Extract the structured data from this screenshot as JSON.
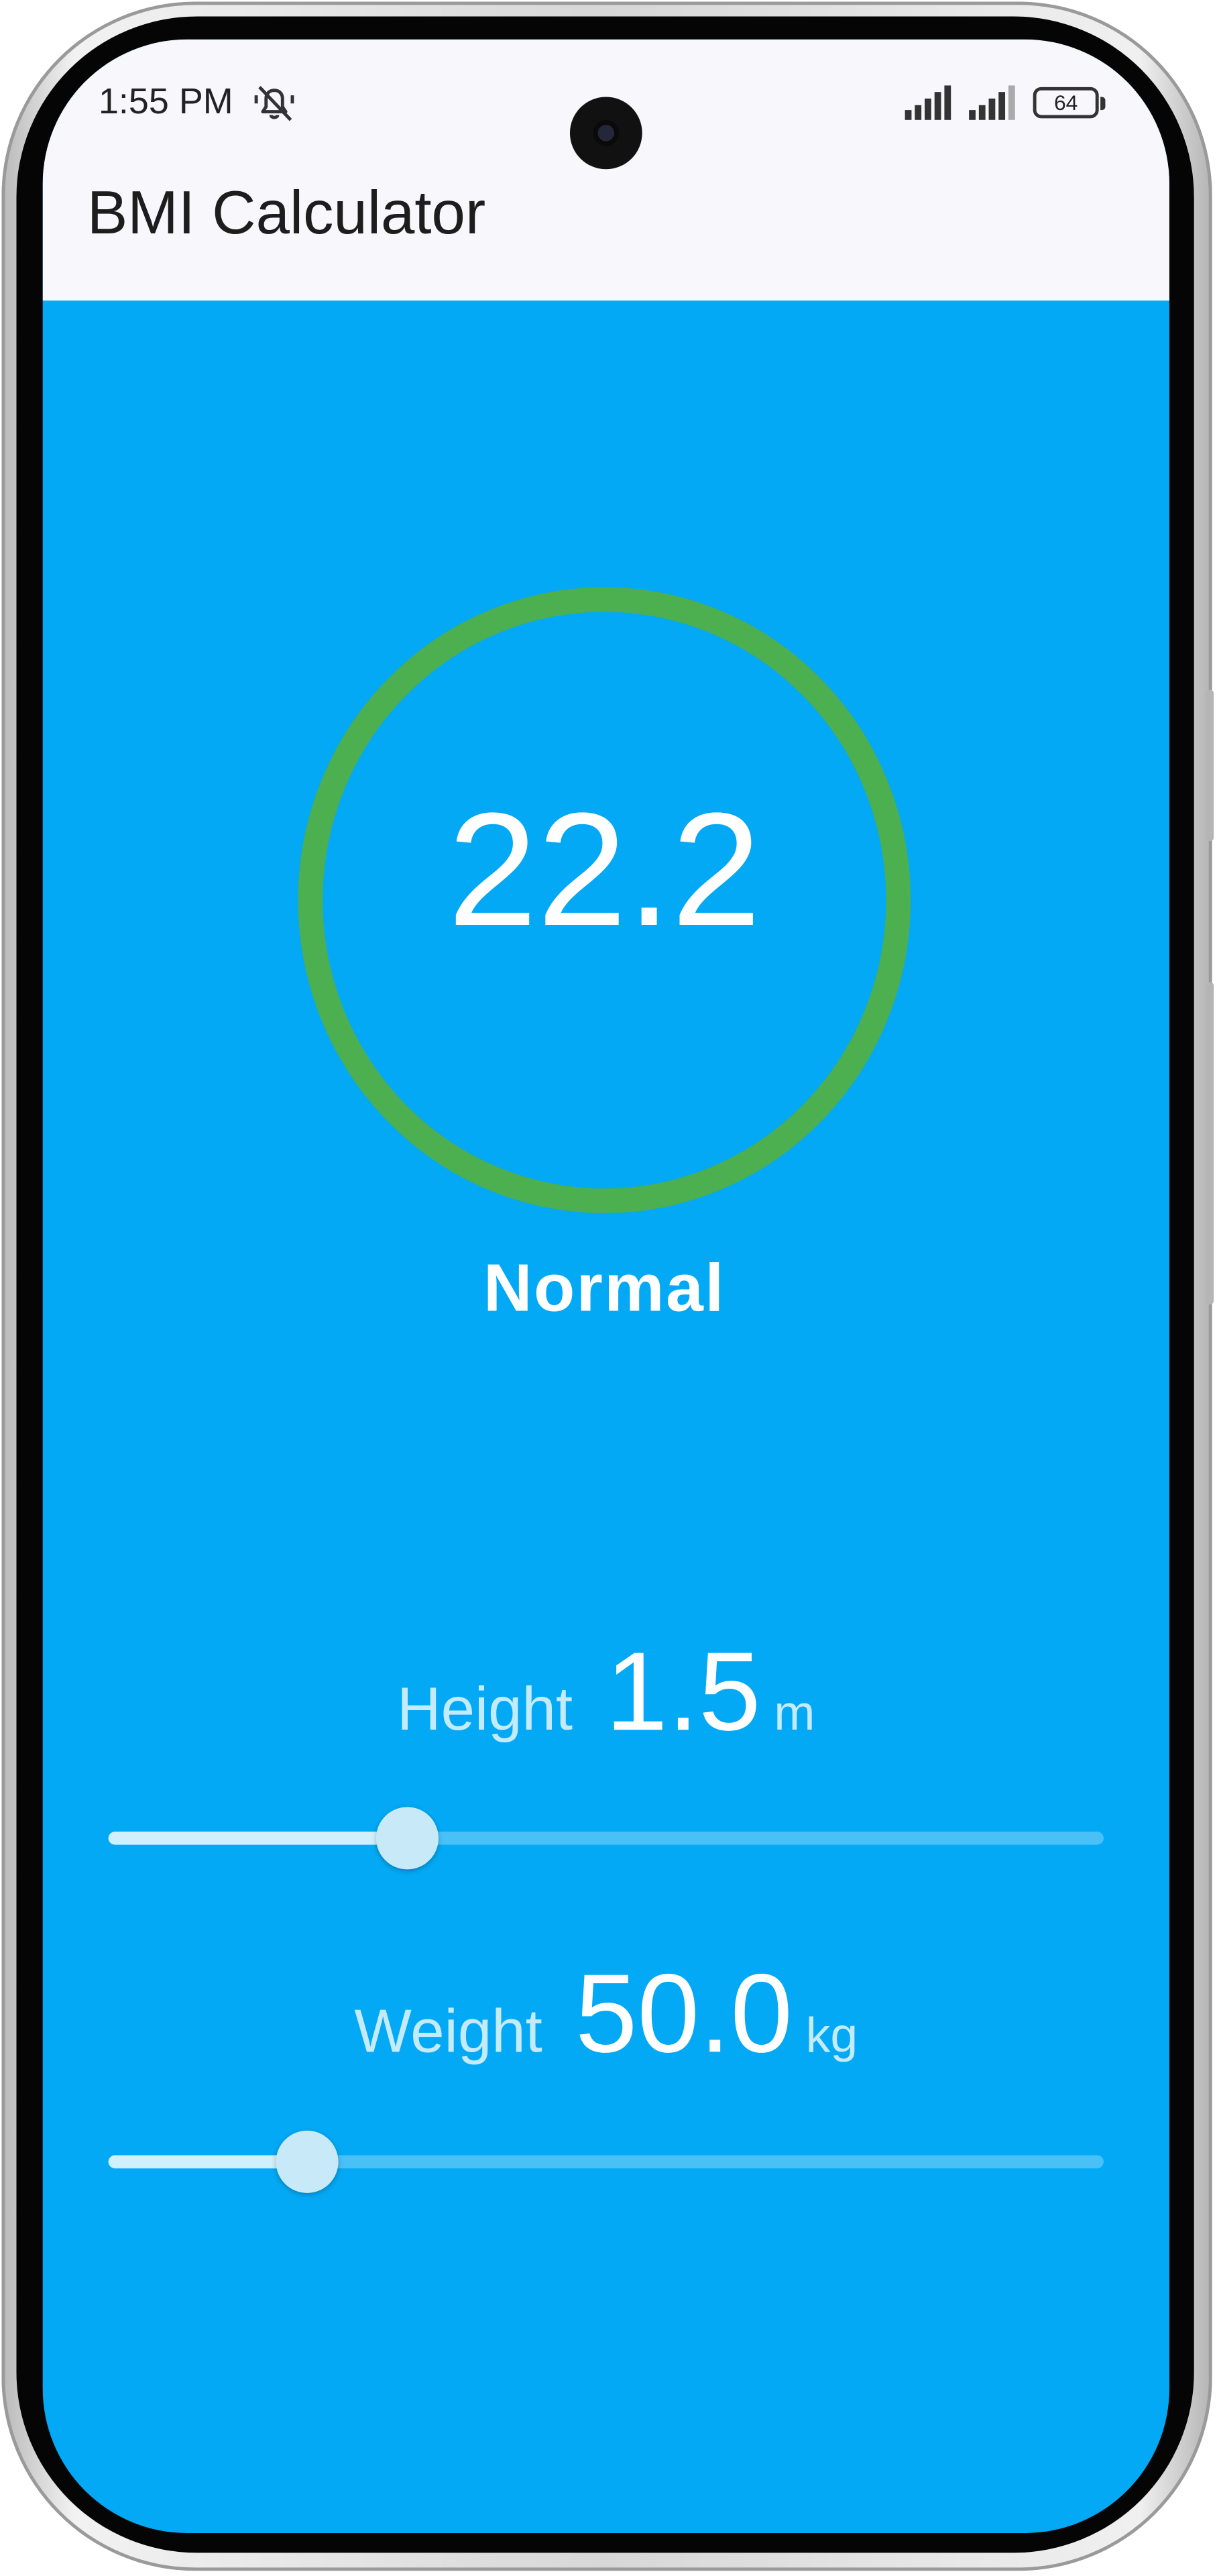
{
  "status_bar": {
    "time": "1:55 PM",
    "battery": "64"
  },
  "app_bar": {
    "title": "BMI Calculator"
  },
  "result": {
    "bmi": "22.2",
    "category": "Normal",
    "ring_color": "#4caf50"
  },
  "height": {
    "label": "Height",
    "value": "1.5",
    "unit": "m",
    "fraction": 0.3
  },
  "weight": {
    "label": "Weight",
    "value": "50.0",
    "unit": "kg",
    "fraction": 0.2
  },
  "colors": {
    "background": "#03a9f4",
    "app_bar": "#f7f7fc",
    "text_on_blue": "#ffffff"
  },
  "icons": [
    "mute-icon",
    "signal-icon",
    "battery-icon"
  ]
}
